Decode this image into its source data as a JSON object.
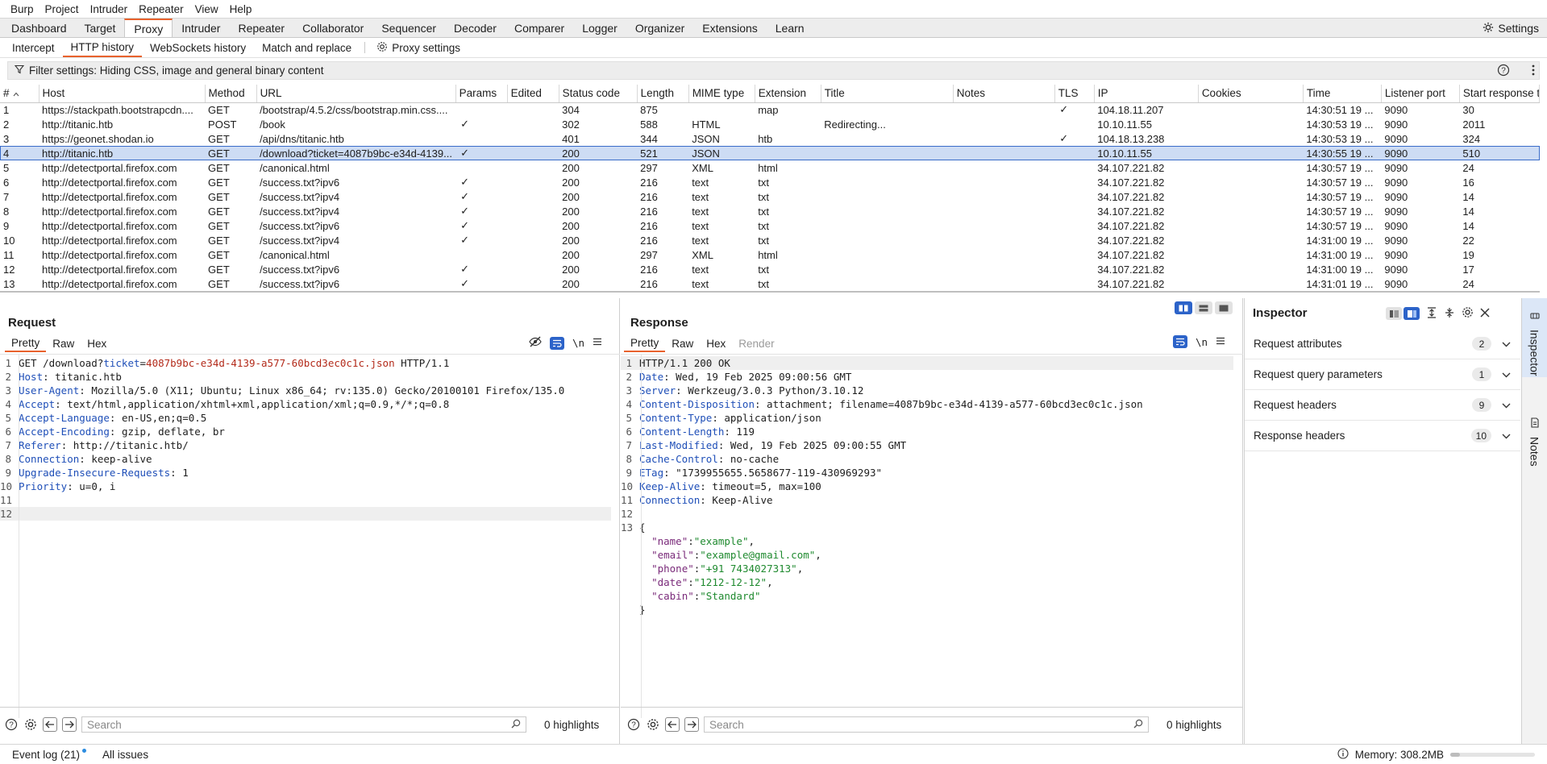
{
  "menu": [
    "Burp",
    "Project",
    "Intruder",
    "Repeater",
    "View",
    "Help"
  ],
  "main_tabs": [
    "Dashboard",
    "Target",
    "Proxy",
    "Intruder",
    "Repeater",
    "Collaborator",
    "Sequencer",
    "Decoder",
    "Comparer",
    "Logger",
    "Organizer",
    "Extensions",
    "Learn"
  ],
  "active_main_tab": "Proxy",
  "settings_label": "Settings",
  "sub_tabs": [
    "Intercept",
    "HTTP history",
    "WebSockets history",
    "Match and replace"
  ],
  "proxy_settings_label": "Proxy settings",
  "filter_text": "Filter settings: Hiding CSS, image and general binary content",
  "table": {
    "columns": [
      "#",
      "Host",
      "Method",
      "URL",
      "Params",
      "Edited",
      "Status code",
      "Length",
      "MIME type",
      "Extension",
      "Title",
      "Notes",
      "TLS",
      "IP",
      "Cookies",
      "Time",
      "Listener port",
      "Start response t"
    ],
    "rows": [
      [
        "1",
        "https://stackpath.bootstrapcdn....",
        "GET",
        "/bootstrap/4.5.2/css/bootstrap.min.css....",
        "",
        "",
        "304",
        "875",
        "",
        "map",
        "",
        "",
        "✓",
        "104.18.11.207",
        "",
        "14:30:51 19 ...",
        "9090",
        "30"
      ],
      [
        "2",
        "http://titanic.htb",
        "POST",
        "/book",
        "✓",
        "",
        "302",
        "588",
        "HTML",
        "",
        "Redirecting...",
        "",
        "",
        "10.10.11.55",
        "",
        "14:30:53 19 ...",
        "9090",
        "2011"
      ],
      [
        "3",
        "https://geonet.shodan.io",
        "GET",
        "/api/dns/titanic.htb",
        "",
        "",
        "401",
        "344",
        "JSON",
        "htb",
        "",
        "",
        "✓",
        "104.18.13.238",
        "",
        "14:30:53 19 ...",
        "9090",
        "324"
      ],
      [
        "4",
        "http://titanic.htb",
        "GET",
        "/download?ticket=4087b9bc-e34d-4139...",
        "✓",
        "",
        "200",
        "521",
        "JSON",
        "",
        "",
        "",
        "",
        "10.10.11.55",
        "",
        "14:30:55 19 ...",
        "9090",
        "510"
      ],
      [
        "5",
        "http://detectportal.firefox.com",
        "GET",
        "/canonical.html",
        "",
        "",
        "200",
        "297",
        "XML",
        "html",
        "",
        "",
        "",
        "34.107.221.82",
        "",
        "14:30:57 19 ...",
        "9090",
        "24"
      ],
      [
        "6",
        "http://detectportal.firefox.com",
        "GET",
        "/success.txt?ipv6",
        "✓",
        "",
        "200",
        "216",
        "text",
        "txt",
        "",
        "",
        "",
        "34.107.221.82",
        "",
        "14:30:57 19 ...",
        "9090",
        "16"
      ],
      [
        "7",
        "http://detectportal.firefox.com",
        "GET",
        "/success.txt?ipv4",
        "✓",
        "",
        "200",
        "216",
        "text",
        "txt",
        "",
        "",
        "",
        "34.107.221.82",
        "",
        "14:30:57 19 ...",
        "9090",
        "14"
      ],
      [
        "8",
        "http://detectportal.firefox.com",
        "GET",
        "/success.txt?ipv4",
        "✓",
        "",
        "200",
        "216",
        "text",
        "txt",
        "",
        "",
        "",
        "34.107.221.82",
        "",
        "14:30:57 19 ...",
        "9090",
        "14"
      ],
      [
        "9",
        "http://detectportal.firefox.com",
        "GET",
        "/success.txt?ipv6",
        "✓",
        "",
        "200",
        "216",
        "text",
        "txt",
        "",
        "",
        "",
        "34.107.221.82",
        "",
        "14:30:57 19 ...",
        "9090",
        "14"
      ],
      [
        "10",
        "http://detectportal.firefox.com",
        "GET",
        "/success.txt?ipv4",
        "✓",
        "",
        "200",
        "216",
        "text",
        "txt",
        "",
        "",
        "",
        "34.107.221.82",
        "",
        "14:31:00 19 ...",
        "9090",
        "22"
      ],
      [
        "11",
        "http://detectportal.firefox.com",
        "GET",
        "/canonical.html",
        "",
        "",
        "200",
        "297",
        "XML",
        "html",
        "",
        "",
        "",
        "34.107.221.82",
        "",
        "14:31:00 19 ...",
        "9090",
        "19"
      ],
      [
        "12",
        "http://detectportal.firefox.com",
        "GET",
        "/success.txt?ipv6",
        "✓",
        "",
        "200",
        "216",
        "text",
        "txt",
        "",
        "",
        "",
        "34.107.221.82",
        "",
        "14:31:00 19 ...",
        "9090",
        "17"
      ],
      [
        "13",
        "http://detectportal.firefox.com",
        "GET",
        "/success.txt?ipv6",
        "✓",
        "",
        "200",
        "216",
        "text",
        "txt",
        "",
        "",
        "",
        "34.107.221.82",
        "",
        "14:31:01 19 ...",
        "9090",
        "24"
      ]
    ],
    "selected_row": 3
  },
  "request": {
    "title": "Request",
    "tabs": [
      "Pretty",
      "Raw",
      "Hex"
    ],
    "newline_label": "\\n",
    "lines": [
      {
        "n": "1",
        "parts": [
          [
            "",
            "GET /download?"
          ],
          [
            "pk",
            "ticket"
          ],
          [
            "",
            "="
          ],
          [
            "pv",
            "4087b9bc-e34d-4139-a577-60bcd3ec0c1c.json"
          ],
          [
            "",
            " HTTP/1.1"
          ]
        ]
      },
      {
        "n": "2",
        "parts": [
          [
            "hk",
            "Host"
          ],
          [
            "",
            ": titanic.htb"
          ]
        ]
      },
      {
        "n": "3",
        "parts": [
          [
            "hk",
            "User-Agent"
          ],
          [
            "",
            ": Mozilla/5.0 (X11; Ubuntu; Linux x86_64; rv:135.0) Gecko/20100101 Firefox/135.0"
          ]
        ]
      },
      {
        "n": "4",
        "parts": [
          [
            "hk",
            "Accept"
          ],
          [
            "",
            ": text/html,application/xhtml+xml,application/xml;q=0.9,*/*;q=0.8"
          ]
        ]
      },
      {
        "n": "5",
        "parts": [
          [
            "hk",
            "Accept-Language"
          ],
          [
            "",
            ": en-US,en;q=0.5"
          ]
        ]
      },
      {
        "n": "6",
        "parts": [
          [
            "hk",
            "Accept-Encoding"
          ],
          [
            "",
            ": gzip, deflate, br"
          ]
        ]
      },
      {
        "n": "7",
        "parts": [
          [
            "hk",
            "Referer"
          ],
          [
            "",
            ": http://titanic.htb/"
          ]
        ]
      },
      {
        "n": "8",
        "parts": [
          [
            "hk",
            "Connection"
          ],
          [
            "",
            ": keep-alive"
          ]
        ]
      },
      {
        "n": "9",
        "parts": [
          [
            "hk",
            "Upgrade-Insecure-Requests"
          ],
          [
            "",
            ": 1"
          ]
        ]
      },
      {
        "n": "10",
        "parts": [
          [
            "hk",
            "Priority"
          ],
          [
            "",
            ": u=0, i"
          ]
        ]
      },
      {
        "n": "11",
        "parts": []
      },
      {
        "n": "12",
        "parts": [],
        "hl": true
      }
    ],
    "search_placeholder": "Search",
    "highlights": "0 highlights"
  },
  "response": {
    "title": "Response",
    "tabs": [
      "Pretty",
      "Raw",
      "Hex",
      "Render"
    ],
    "newline_label": "\\n",
    "lines": [
      {
        "n": "1",
        "parts": [
          [
            "",
            "HTTP/1.1 200 OK"
          ]
        ],
        "hl": true
      },
      {
        "n": "2",
        "parts": [
          [
            "hk",
            "Date"
          ],
          [
            "",
            ": Wed, 19 Feb 2025 09:00:56 GMT"
          ]
        ]
      },
      {
        "n": "3",
        "parts": [
          [
            "hk",
            "Server"
          ],
          [
            "",
            ": Werkzeug/3.0.3 Python/3.10.12"
          ]
        ]
      },
      {
        "n": "4",
        "parts": [
          [
            "hk",
            "Content-Disposition"
          ],
          [
            "",
            ": attachment; filename=4087b9bc-e34d-4139-a577-60bcd3ec0c1c.json"
          ]
        ]
      },
      {
        "n": "5",
        "parts": [
          [
            "hk",
            "Content-Type"
          ],
          [
            "",
            ": application/json"
          ]
        ]
      },
      {
        "n": "6",
        "parts": [
          [
            "hk",
            "Content-Length"
          ],
          [
            "",
            ": 119"
          ]
        ]
      },
      {
        "n": "7",
        "parts": [
          [
            "hk",
            "Last-Modified"
          ],
          [
            "",
            ": Wed, 19 Feb 2025 09:00:55 GMT"
          ]
        ]
      },
      {
        "n": "8",
        "parts": [
          [
            "hk",
            "Cache-Control"
          ],
          [
            "",
            ": no-cache"
          ]
        ]
      },
      {
        "n": "9",
        "parts": [
          [
            "hk",
            "ETag"
          ],
          [
            "",
            ": \"1739955655.5658677-119-430969293\""
          ]
        ]
      },
      {
        "n": "10",
        "parts": [
          [
            "hk",
            "Keep-Alive"
          ],
          [
            "",
            ": timeout=5, max=100"
          ]
        ]
      },
      {
        "n": "11",
        "parts": [
          [
            "hk",
            "Connection"
          ],
          [
            "",
            ": Keep-Alive"
          ]
        ]
      },
      {
        "n": "12",
        "parts": []
      },
      {
        "n": "13",
        "parts": [
          [
            "",
            "{"
          ]
        ]
      },
      {
        "n": "",
        "parts": [
          [
            "",
            "  "
          ],
          [
            "jk",
            "\"name\""
          ],
          [
            "",
            ":"
          ],
          [
            "js",
            "\"example\""
          ],
          [
            "",
            ","
          ]
        ]
      },
      {
        "n": "",
        "parts": [
          [
            "",
            "  "
          ],
          [
            "jk",
            "\"email\""
          ],
          [
            "",
            ":"
          ],
          [
            "js",
            "\"example@gmail.com\""
          ],
          [
            "",
            ","
          ]
        ]
      },
      {
        "n": "",
        "parts": [
          [
            "",
            "  "
          ],
          [
            "jk",
            "\"phone\""
          ],
          [
            "",
            ":"
          ],
          [
            "js",
            "\"+91 7434027313\""
          ],
          [
            "",
            ","
          ]
        ]
      },
      {
        "n": "",
        "parts": [
          [
            "",
            "  "
          ],
          [
            "jk",
            "\"date\""
          ],
          [
            "",
            ":"
          ],
          [
            "js",
            "\"1212-12-12\""
          ],
          [
            "",
            ","
          ]
        ]
      },
      {
        "n": "",
        "parts": [
          [
            "",
            "  "
          ],
          [
            "jk",
            "\"cabin\""
          ],
          [
            "",
            ":"
          ],
          [
            "js",
            "\"Standard\""
          ]
        ]
      },
      {
        "n": "",
        "parts": [
          [
            "",
            "}"
          ]
        ]
      }
    ],
    "search_placeholder": "Search",
    "highlights": "0 highlights"
  },
  "inspector": {
    "title": "Inspector",
    "sections": [
      {
        "label": "Request attributes",
        "count": "2"
      },
      {
        "label": "Request query parameters",
        "count": "1"
      },
      {
        "label": "Request headers",
        "count": "9"
      },
      {
        "label": "Response headers",
        "count": "10"
      }
    ]
  },
  "side_tabs": [
    "Inspector",
    "Notes"
  ],
  "status": {
    "event_log": "Event log (21)",
    "all_issues": "All issues",
    "memory": "Memory: 308.2MB"
  },
  "colors": {
    "accent": "#e8622d",
    "selection": "#cddcf4",
    "blue": "#1f4fb8"
  }
}
